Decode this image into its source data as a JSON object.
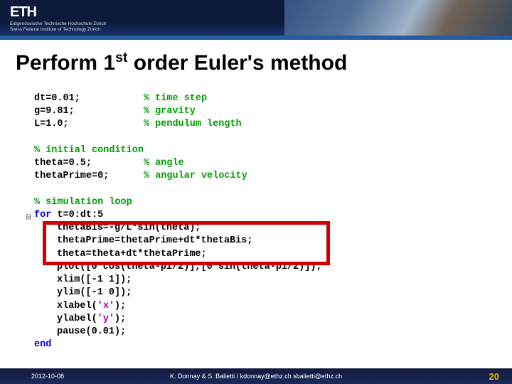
{
  "header": {
    "logo": "ETH",
    "subline1": "Eidgenössische Technische Hochschule Zürich",
    "subline2": "Swiss Federal Institute of Technology Zurich"
  },
  "title": {
    "pre": "Perform 1",
    "sup": "st",
    "post": " order Euler's method"
  },
  "code": {
    "l1a": "dt=0.01;           ",
    "l1c": "% time step",
    "l2a": "g=9.81;            ",
    "l2c": "% gravity",
    "l3a": "L=1.0;             ",
    "l3c": "% pendulum length",
    "blank1": " ",
    "l4c": "% initial condition",
    "l5a": "theta=0.5;         ",
    "l5c": "% angle",
    "l6a": "thetaPrime=0;      ",
    "l6c": "% angular velocity",
    "blank2": " ",
    "l7c": "% simulation loop",
    "l8kw": "for",
    "l8a": " t=0:dt:5",
    "l9": "thetaBis=-g/L*sin(theta);",
    "l10": "thetaPrime=thetaPrime+dt*thetaBis;",
    "l11": "theta=theta+dt*thetaPrime;",
    "l12a": "plot([0 cos(theta-pi/2)],[0 sin(theta-pi/2)]);",
    "l13": "xlim([-1 1]);",
    "l14": "ylim([-1 0]);",
    "l15a": "xlabel(",
    "l15s": "'x'",
    "l15b": ");",
    "l16a": "ylabel(",
    "l16s": "'y'",
    "l16b": ");",
    "l17": "pause(0.01);",
    "l18kw": "end"
  },
  "loop_mark": "⊟",
  "footer": {
    "date": "2012-10-08",
    "center": "K. Donnay & S. Balietti / kdonnay@ethz.ch   sbalietti@ethz.ch",
    "page": "20"
  }
}
